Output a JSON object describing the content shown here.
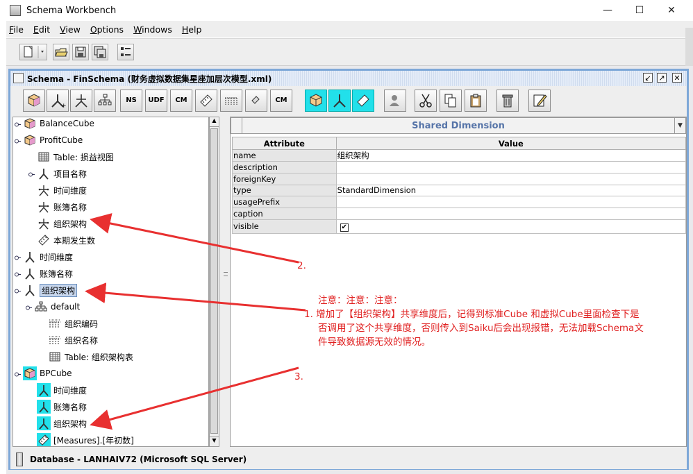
{
  "window": {
    "title": "Schema Workbench",
    "minimize": "—",
    "maximize": "☐",
    "close": "✕"
  },
  "menu": [
    {
      "mnemonic": "F",
      "rest": "ile"
    },
    {
      "mnemonic": "E",
      "rest": "dit"
    },
    {
      "mnemonic": "V",
      "rest": "iew"
    },
    {
      "mnemonic": "O",
      "rest": "ptions"
    },
    {
      "mnemonic": "W",
      "rest": "indows"
    },
    {
      "mnemonic": "H",
      "rest": "elp"
    }
  ],
  "schema_frame": {
    "title": "Schema - FinSchema (财务虚拟数据集星座加层次模型.xml)"
  },
  "toolbar2": {
    "ns": "NS",
    "udf": "UDF",
    "cm": "CM",
    "cm2": "CM"
  },
  "tree": [
    {
      "label": "BalanceCube",
      "icon": "cube-icon"
    },
    {
      "label": "ProfitCube",
      "icon": "cube-icon"
    },
    {
      "label": "Table: 损益视图",
      "icon": "table-icon"
    },
    {
      "label": "项目名称",
      "icon": "dimension-icon"
    },
    {
      "label": "时间维度",
      "icon": "dimension-usage-icon"
    },
    {
      "label": "账簿名称",
      "icon": "dimension-usage-icon"
    },
    {
      "label": "组织架构",
      "icon": "dimension-usage-icon"
    },
    {
      "label": "本期发生数",
      "icon": "measure-icon"
    },
    {
      "label": "时间维度",
      "icon": "dimension-icon"
    },
    {
      "label": "账簿名称",
      "icon": "dimension-icon"
    },
    {
      "label": "组织架构",
      "icon": "dimension-icon"
    },
    {
      "label": "default",
      "icon": "hierarchy-icon"
    },
    {
      "label": "组织编码",
      "icon": "level-icon"
    },
    {
      "label": "组织名称",
      "icon": "level-icon"
    },
    {
      "label": "Table: 组织架构表",
      "icon": "table-icon"
    },
    {
      "label": "BPCube",
      "icon": "cube-icon"
    },
    {
      "label": "时间维度",
      "icon": "dimension-icon"
    },
    {
      "label": "账簿名称",
      "icon": "dimension-icon"
    },
    {
      "label": "组织架构",
      "icon": "dimension-icon"
    },
    {
      "label": "[Measures].[年初数]",
      "icon": "measure-icon"
    }
  ],
  "properties": {
    "header": "Shared Dimension",
    "col_attribute": "Attribute",
    "col_value": "Value",
    "rows": [
      {
        "attr": "name",
        "value": "组织架构"
      },
      {
        "attr": "description",
        "value": ""
      },
      {
        "attr": "foreignKey",
        "value": ""
      },
      {
        "attr": "type",
        "value": "StandardDimension"
      },
      {
        "attr": "usagePrefix",
        "value": ""
      },
      {
        "attr": "caption",
        "value": ""
      },
      {
        "attr": "visible",
        "value": "✔"
      }
    ]
  },
  "status": {
    "text": "Database - LANHAIV72 (Microsoft SQL Server)"
  },
  "annotations": {
    "label2": "2.",
    "label3": "3.",
    "note_title": "注意：注意：注意：",
    "note_line1": "1. 增加了【组织架构】共享维度后，记得到标准Cube 和虚拟Cube里面检查下是",
    "note_line2": "否调用了这个共享维度，否则传入到Saiku后会出现报错，无法加载Schema文",
    "note_line3": "件导致数据源无效的情况。",
    "color": "#e02020"
  }
}
